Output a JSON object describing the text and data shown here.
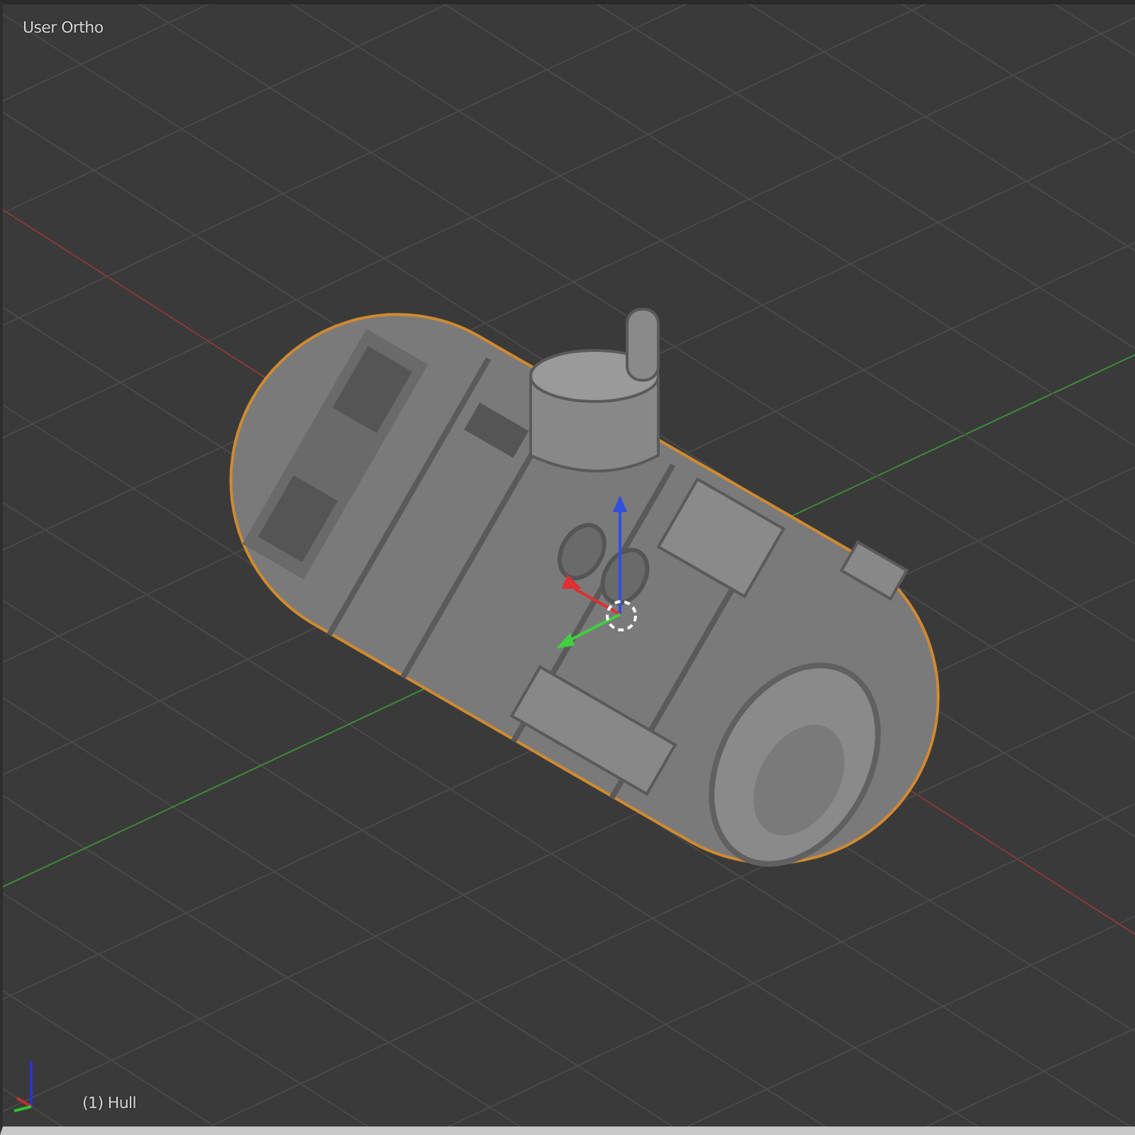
{
  "viewport": {
    "view_label": "User Ortho",
    "object_label": "(1) Hull"
  }
}
